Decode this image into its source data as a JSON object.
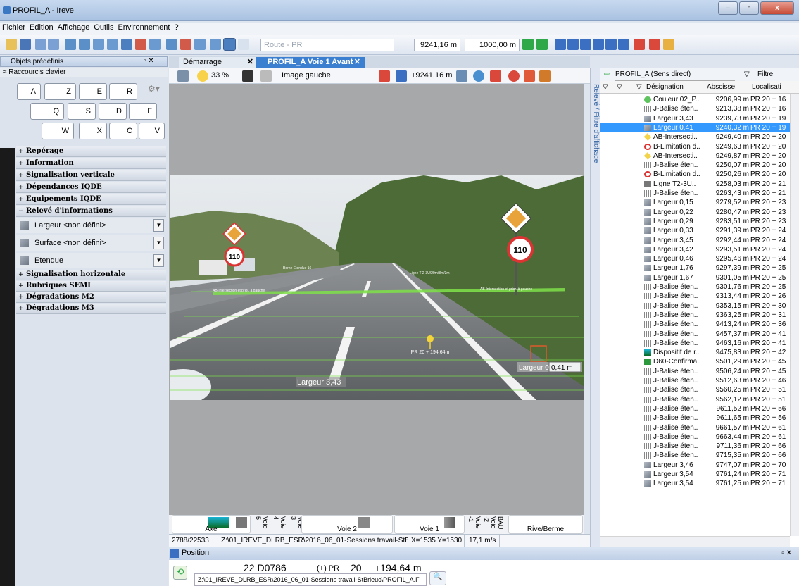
{
  "window": {
    "title": "PROFIL_A - Ireve",
    "btn_min": "–",
    "btn_max": "▫",
    "btn_close": "x"
  },
  "menu": [
    "Fichier",
    "Edition",
    "Affichage",
    "Outils",
    "Environnement",
    "?"
  ],
  "toolbar": {
    "route_placeholder": "Route - PR",
    "distance": "9241,16 m",
    "step": "1000,00 m"
  },
  "left": {
    "panel_title": "Objets prédéfinis",
    "pin": "▫ ✕",
    "shortcuts_title": "≈ Raccourcis clavier",
    "keys": [
      "A",
      "Z",
      "E",
      "R",
      "Q",
      "S",
      "D",
      "F",
      "W",
      "X",
      "C",
      "V"
    ],
    "sections_top": [
      "Repérage",
      "Information",
      "Signalisation verticale",
      "Dépendances IQDE",
      "Equipements IQDE",
      "Relevé d'informations"
    ],
    "releve_items": [
      "Largeur <non défini>",
      "Surface <non défini>",
      "Etendue"
    ],
    "sections_bottom": [
      "Signalisation horizontale",
      "Rubriques SEMI",
      "Dégradations M2",
      "Dégradations M3"
    ]
  },
  "tabs": [
    "Démarrage",
    "PROFIL_A Voie 1 Avant"
  ],
  "viewer_toolbar": {
    "zoom": "33 %",
    "image": "Image gauche",
    "pos": "+9241,16 m"
  },
  "overlay": {
    "pr_label": "PR 20 + 194,64m",
    "largeur_left": "Largeur 3,43",
    "largeur_right": "Largeur 0,",
    "largeur_right_val": "0,41 m",
    "sign_speed": "110",
    "small_label_1": "Borne Etendue 16",
    "small_label_2": "Ligne T 2-3U/20m/8m/3m",
    "small_label_3": "AB-Intersection et prior. à gauche",
    "small_label_4": "AB-Intersection et prior. à gauche"
  },
  "lanes": {
    "axe": "Axe",
    "voie5": "Voie 5",
    "voie4": "Voie 4",
    "voie3": "Voie 3",
    "voie2": "Voie 2",
    "voie1": "Voie 1",
    "voiem1": "Voie -1",
    "voiem2": "Voie -2",
    "bau": "BAU",
    "rive": "Rive/Berme"
  },
  "status": {
    "frame": "2788/22533",
    "path": "Z:\\01_IREVE_DLRB_ESR\\2016_06_01-Sessions travail-StBrieuc\\PROFIL_A.F",
    "coords": "X=1535 Y=1530",
    "speed": "17,1 m/s"
  },
  "vstrip_label": "Relevé / Filtre d'affichage",
  "right": {
    "profile": "PROFIL_A (Sens direct)",
    "filter": "Filtre",
    "col_designation": "Désignation",
    "col_abscisse": "Abscisse",
    "col_localisation": "Localisati",
    "rows": [
      {
        "icon": "green-circle",
        "name": "Couleur 02_P..",
        "abs": "9206,99 m",
        "loc": "PR 20 + 16"
      },
      {
        "icon": "balise",
        "name": "J-Balise éten..",
        "abs": "9213,38 m",
        "loc": "PR 20 + 16"
      },
      {
        "icon": "largeur",
        "name": "Largeur 3,43",
        "abs": "9239,73 m",
        "loc": "PR 20 + 19"
      },
      {
        "icon": "largeur",
        "name": "Largeur 0,41",
        "abs": "9240,32 m",
        "loc": "PR 20 + 19",
        "sel": true
      },
      {
        "icon": "diamond",
        "name": "AB-Intersecti..",
        "abs": "9249,40 m",
        "loc": "PR 20 + 20"
      },
      {
        "icon": "speed",
        "name": "B-Limitation d..",
        "abs": "9249,63 m",
        "loc": "PR 20 + 20"
      },
      {
        "icon": "diamond",
        "name": "AB-Intersecti..",
        "abs": "9249,87 m",
        "loc": "PR 20 + 20"
      },
      {
        "icon": "balise",
        "name": "J-Balise éten..",
        "abs": "9250,07 m",
        "loc": "PR 20 + 20"
      },
      {
        "icon": "speed",
        "name": "B-Limitation d..",
        "abs": "9250,26 m",
        "loc": "PR 20 + 20"
      },
      {
        "icon": "ligne",
        "name": "Ligne T2-3U..",
        "abs": "9258,03 m",
        "loc": "PR 20 + 21"
      },
      {
        "icon": "balise",
        "name": "J-Balise éten..",
        "abs": "9263,43 m",
        "loc": "PR 20 + 21"
      },
      {
        "icon": "largeur",
        "name": "Largeur 0,15",
        "abs": "9279,52 m",
        "loc": "PR 20 + 23"
      },
      {
        "icon": "largeur",
        "name": "Largeur 0,22",
        "abs": "9280,47 m",
        "loc": "PR 20 + 23"
      },
      {
        "icon": "largeur",
        "name": "Largeur 0,29",
        "abs": "9283,51 m",
        "loc": "PR 20 + 23"
      },
      {
        "icon": "largeur",
        "name": "Largeur 0,33",
        "abs": "9291,39 m",
        "loc": "PR 20 + 24"
      },
      {
        "icon": "largeur",
        "name": "Largeur 3,45",
        "abs": "9292,44 m",
        "loc": "PR 20 + 24"
      },
      {
        "icon": "largeur",
        "name": "Largeur 3,42",
        "abs": "9293,51 m",
        "loc": "PR 20 + 24"
      },
      {
        "icon": "largeur",
        "name": "Largeur 0,46",
        "abs": "9295,46 m",
        "loc": "PR 20 + 24"
      },
      {
        "icon": "largeur",
        "name": "Largeur 1,76",
        "abs": "9297,39 m",
        "loc": "PR 20 + 25"
      },
      {
        "icon": "largeur",
        "name": "Largeur 1,67",
        "abs": "9301,05 m",
        "loc": "PR 20 + 25"
      },
      {
        "icon": "balise",
        "name": "J-Balise éten..",
        "abs": "9301,76 m",
        "loc": "PR 20 + 25"
      },
      {
        "icon": "balise",
        "name": "J-Balise éten..",
        "abs": "9313,44 m",
        "loc": "PR 20 + 26"
      },
      {
        "icon": "balise",
        "name": "J-Balise éten..",
        "abs": "9353,15 m",
        "loc": "PR 20 + 30"
      },
      {
        "icon": "balise",
        "name": "J-Balise éten..",
        "abs": "9363,25 m",
        "loc": "PR 20 + 31"
      },
      {
        "icon": "balise",
        "name": "J-Balise éten..",
        "abs": "9413,24 m",
        "loc": "PR 20 + 36"
      },
      {
        "icon": "balise",
        "name": "J-Balise éten..",
        "abs": "9457,37 m",
        "loc": "PR 20 + 41"
      },
      {
        "icon": "balise",
        "name": "J-Balise éten..",
        "abs": "9463,16 m",
        "loc": "PR 20 + 41"
      },
      {
        "icon": "dispositif",
        "name": "Dispositif de r..",
        "abs": "9475,83 m",
        "loc": "PR 20 + 42"
      },
      {
        "icon": "d60",
        "name": "D60-Confirma..",
        "abs": "9501,29 m",
        "loc": "PR 20 + 45"
      },
      {
        "icon": "balise",
        "name": "J-Balise éten..",
        "abs": "9506,24 m",
        "loc": "PR 20 + 45"
      },
      {
        "icon": "balise",
        "name": "J-Balise éten..",
        "abs": "9512,63 m",
        "loc": "PR 20 + 46"
      },
      {
        "icon": "balise",
        "name": "J-Balise éten..",
        "abs": "9560,25 m",
        "loc": "PR 20 + 51"
      },
      {
        "icon": "balise",
        "name": "J-Balise éten..",
        "abs": "9562,12 m",
        "loc": "PR 20 + 51"
      },
      {
        "icon": "balise",
        "name": "J-Balise éten..",
        "abs": "9611,52 m",
        "loc": "PR 20 + 56"
      },
      {
        "icon": "balise",
        "name": "J-Balise éten..",
        "abs": "9611,65 m",
        "loc": "PR 20 + 56"
      },
      {
        "icon": "balise",
        "name": "J-Balise éten..",
        "abs": "9661,57 m",
        "loc": "PR 20 + 61"
      },
      {
        "icon": "balise",
        "name": "J-Balise éten..",
        "abs": "9663,44 m",
        "loc": "PR 20 + 61"
      },
      {
        "icon": "balise",
        "name": "J-Balise éten..",
        "abs": "9711,36 m",
        "loc": "PR 20 + 66"
      },
      {
        "icon": "balise",
        "name": "J-Balise éten..",
        "abs": "9715,35 m",
        "loc": "PR 20 + 66"
      },
      {
        "icon": "largeur",
        "name": "Largeur 3,46",
        "abs": "9747,07 m",
        "loc": "PR 20 + 70"
      },
      {
        "icon": "largeur",
        "name": "Largeur 3,54",
        "abs": "9761,24 m",
        "loc": "PR 20 + 71"
      },
      {
        "icon": "largeur",
        "name": "Largeur 3,54",
        "abs": "9761,25 m",
        "loc": "PR 20 + 71"
      }
    ]
  },
  "position": {
    "title": "Position",
    "pin": "▫ ✕",
    "road": "22 D0786",
    "pr_prefix": "(+) PR",
    "pr_num": "20",
    "pr_plus": "+194,64 m",
    "path": "Z:\\01_IREVE_DLRB_ESR\\2016_06_01-Sessions travail-StBrieuc\\PROFIL_A.F"
  }
}
